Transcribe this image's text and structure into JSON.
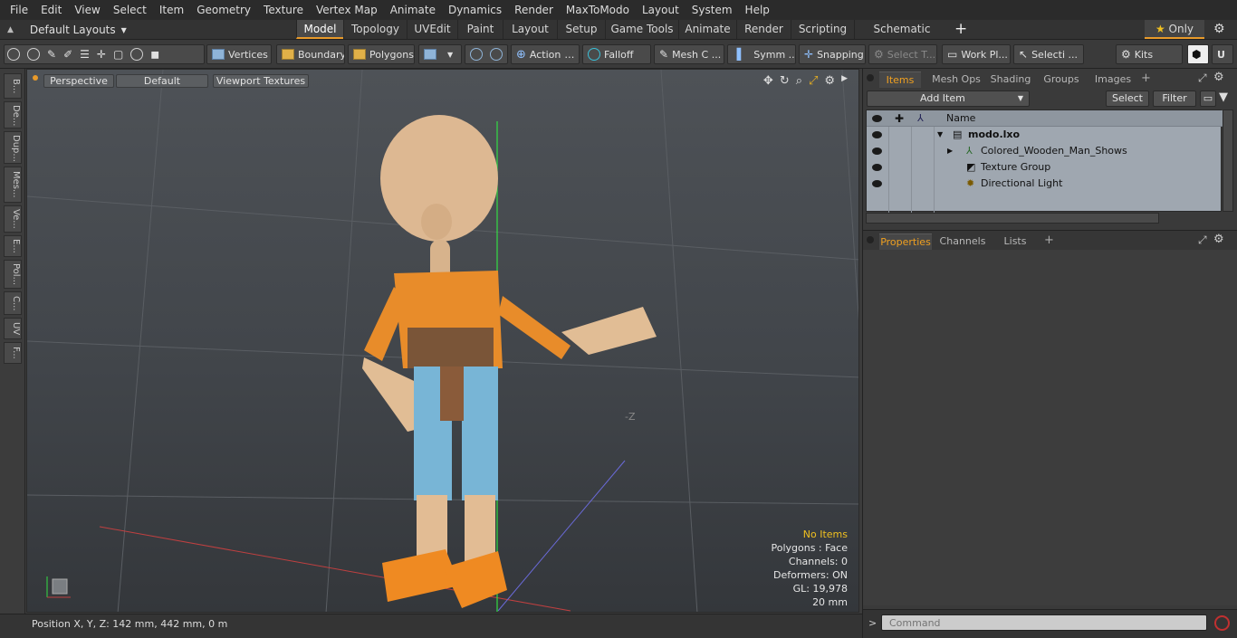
{
  "menu": [
    "File",
    "Edit",
    "View",
    "Select",
    "Item",
    "Geometry",
    "Texture",
    "Vertex Map",
    "Animate",
    "Dynamics",
    "Render",
    "MaxToModo",
    "Layout",
    "System",
    "Help"
  ],
  "layouts": {
    "label": "Default Layouts"
  },
  "tabs": [
    "Model",
    "Topology",
    "UVEdit",
    "Paint",
    "Layout",
    "Setup",
    "Game Tools",
    "Animate",
    "Render",
    "Scripting",
    "Schematic Fusion"
  ],
  "only_label": "Only",
  "toolbar": {
    "vertices": "Vertices",
    "boundary": "Boundary",
    "polygons": "Polygons",
    "action": "Action",
    "falloff": "Falloff",
    "meshc": "Mesh C ...",
    "symm": "Symm ...",
    "snapping": "Snapping",
    "selectt": "Select T...",
    "workpl": "Work Pl...",
    "selecti": "Selecti ...",
    "kits": "Kits"
  },
  "left_tabs": [
    "B...",
    "De...",
    "Dup...",
    "Mes...",
    "Ve...",
    "E...",
    "Pol...",
    "C...",
    "UV",
    "F..."
  ],
  "viewport": {
    "perspective": "Perspective",
    "default": "Default",
    "textures": "Viewport Textures",
    "axis_label": "-Z",
    "info": {
      "items": "No Items",
      "polygons": "Polygons : Face",
      "channels": "Channels: 0",
      "deformers": "Deformers: ON",
      "gl": "GL: 19,978",
      "scale": "20 mm"
    },
    "colors": {
      "items_info": "#f0c020",
      "y_axis": "#33dd44"
    }
  },
  "status": {
    "position": "Position X, Y, Z:   142 mm, 442 mm, 0 m"
  },
  "panel": {
    "tabs": [
      "Items",
      "Mesh Ops",
      "Shading",
      "Groups",
      "Images"
    ],
    "add_item": "Add Item",
    "select": "Select",
    "filter": "Filter",
    "col_name": "Name",
    "tree": [
      {
        "name": "modo.lxo",
        "bold": true
      },
      {
        "name": "Colored_Wooden_Man_Shows"
      },
      {
        "name": "Texture Group"
      },
      {
        "name": "Directional Light"
      }
    ],
    "prop_tabs": [
      "Properties",
      "Channels",
      "Lists"
    ],
    "command_placeholder": "Command",
    "accent": "#f0a020"
  }
}
